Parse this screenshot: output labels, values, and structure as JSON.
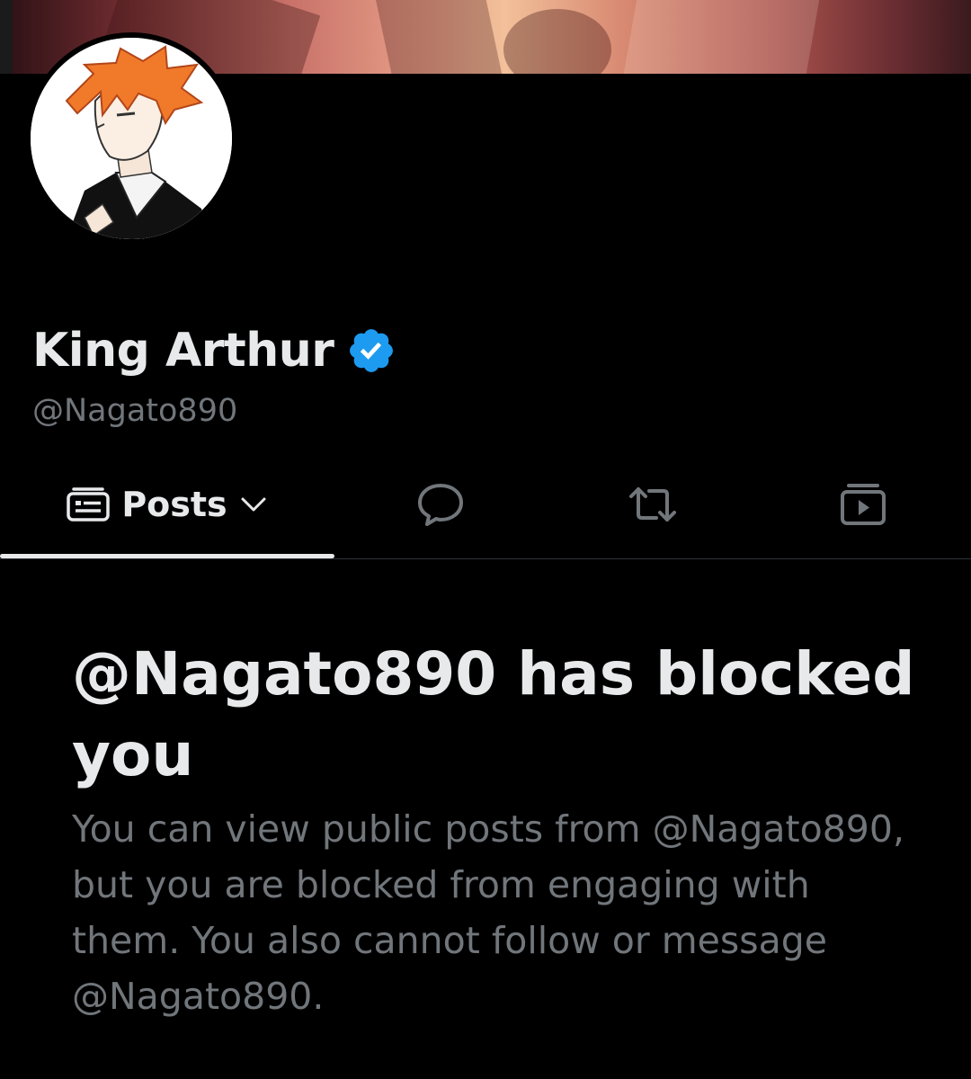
{
  "profile": {
    "display_name": "King Arthur",
    "handle": "@Nagato890",
    "verified_color": "#1d9bf0"
  },
  "tabs": {
    "posts_label": "Posts",
    "replies_icon": "speech-bubble-icon",
    "reposts_icon": "repost-icon",
    "media_icon": "media-play-icon"
  },
  "block_notice": {
    "title": "@Nagato890 has blocked you",
    "body": "You can view public posts from @Nagato890, but you are blocked from engaging with them. You also cannot follow or message @Nagato890."
  }
}
